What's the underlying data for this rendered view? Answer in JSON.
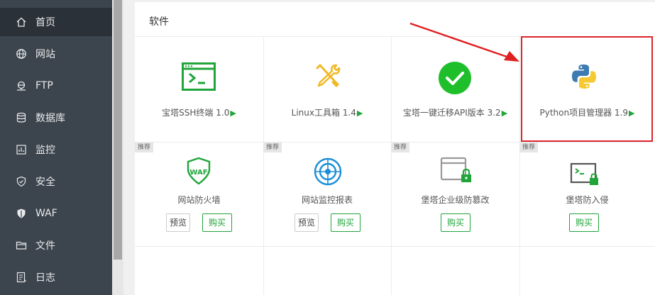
{
  "sidebar": {
    "items": [
      {
        "label": "首页",
        "icon": "home-icon",
        "active": true
      },
      {
        "label": "网站",
        "icon": "globe-icon"
      },
      {
        "label": "FTP",
        "icon": "ftp-icon"
      },
      {
        "label": "数据库",
        "icon": "database-icon"
      },
      {
        "label": "监控",
        "icon": "monitor-icon"
      },
      {
        "label": "安全",
        "icon": "shield-icon"
      },
      {
        "label": "WAF",
        "icon": "waf-icon"
      },
      {
        "label": "文件",
        "icon": "folder-icon"
      },
      {
        "label": "日志",
        "icon": "log-icon"
      }
    ]
  },
  "panel": {
    "title": "软件",
    "row1": [
      {
        "label": "宝塔SSH终端 1.0",
        "icon": "terminal-icon"
      },
      {
        "label": "Linux工具箱 1.4",
        "icon": "tools-icon"
      },
      {
        "label": "宝塔一键迁移API版本 3.2",
        "icon": "check-circle-icon"
      },
      {
        "label": "Python项目管理器 1.9",
        "icon": "python-icon"
      }
    ],
    "row2": [
      {
        "badge": "推荐",
        "label": "网站防火墙",
        "icon": "waf-shield-icon",
        "preview": "预览",
        "buy": "购买"
      },
      {
        "badge": "推荐",
        "label": "网站监控报表",
        "icon": "radar-icon",
        "preview": "预览",
        "buy": "购买"
      },
      {
        "badge": "推荐",
        "label": "堡塔企业级防篡改",
        "icon": "lock-window-icon",
        "buy": "购买"
      },
      {
        "badge": "推荐",
        "label": "堡塔防入侵",
        "icon": "intrusion-terminal-icon",
        "buy": "购买"
      }
    ],
    "play_symbol": "▶"
  },
  "colors": {
    "sidebar_bg": "#3c444d",
    "accent_green": "#20a53a",
    "highlight_red": "#d9262c"
  }
}
